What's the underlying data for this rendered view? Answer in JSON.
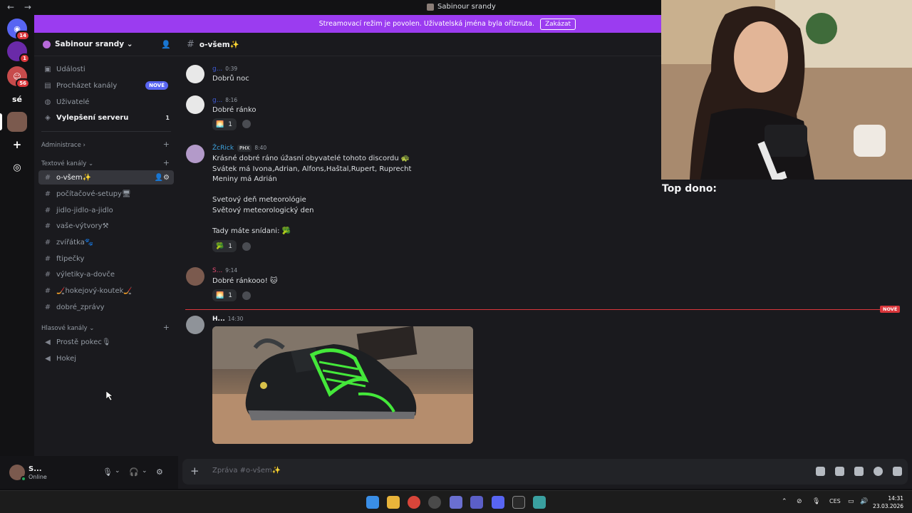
{
  "titlebar": {
    "back": "←",
    "forward": "→",
    "title": "Sabinour srandy"
  },
  "rail": {
    "servers": [
      {
        "name": "discord-home",
        "badge": "14",
        "color": "#5865f2",
        "glyph": "◉"
      },
      {
        "name": "purple-server",
        "badge": "1",
        "color": "#6a2aa8",
        "glyph": ""
      },
      {
        "name": "emoji-server",
        "badge": "56",
        "color": "#c74b4b",
        "glyph": "☺"
      },
      {
        "name": "se-server",
        "badge": "",
        "color": "#121214",
        "glyph": "sé"
      },
      {
        "name": "sabinour-server",
        "badge": "",
        "color": "#7b5a4e",
        "glyph": ""
      },
      {
        "name": "add-server",
        "badge": "",
        "color": "#121214",
        "glyph": "+"
      },
      {
        "name": "discover",
        "badge": "",
        "color": "#121214",
        "glyph": "◎"
      }
    ]
  },
  "banner": {
    "text": "Streamovací režim je povolen. Uživatelská jména byla oříznuta.",
    "button": "Zakázat"
  },
  "sidebar": {
    "server_name": "Sabinour srandy ⌄",
    "top_items": [
      {
        "label": "Události",
        "icon": "▣"
      },
      {
        "label": "Procházet kanály",
        "icon": "▤",
        "pill": "NOVÉ"
      },
      {
        "label": "Uživatelé",
        "icon": "👥"
      },
      {
        "label": "Vylepšení serveru",
        "icon": "◈",
        "count": "1"
      }
    ],
    "categories": {
      "admin": "Administrace ›",
      "text": "Textové kanály ⌄",
      "voice": "Hlasové kanály ⌄"
    },
    "text_channels": [
      "o-všem✨",
      "počítačové-setupy🖥",
      "jidlo-jidlo-a-jidlo",
      "vaše-výtvory⚒",
      "zvířátka🐾",
      "ftipečky",
      "výletiky-a-dovče",
      "🏒hokejový-koutek🏒",
      "dobré_zprávy"
    ],
    "voice_channels": [
      "Prostě pokec🎙",
      "Hokej"
    ]
  },
  "user": {
    "name": "S...",
    "status": "Online"
  },
  "chat": {
    "channel": "o-všem✨",
    "composer_placeholder": "Zpráva #o-všem✨",
    "new_tag": "NOVÉ",
    "messages": [
      {
        "author": "g...",
        "time": "0:39",
        "text": "Dobrů noc"
      },
      {
        "author": "g...",
        "time": "8:16",
        "text": "Dobré ránko",
        "reaction_count": "1"
      },
      {
        "author": "ŽcRick",
        "tag": "PHX",
        "time": "8:40",
        "text": "Krásné dobré ráno úžasní obyvatelé tohoto discordu 🐢\nSvátek má Ivona,Adrian, Alfons,Haštal,Rupert, Ruprecht\nMeniny má Adrián\n\nSvetový deň meteorológie\nSvětový meteorologický den\n\nTady máte snídani: 🥦",
        "reaction_count": "1"
      },
      {
        "author": "S...",
        "time": "9:14",
        "text": "Dobré ránkooo! 🐱",
        "reaction_count": "1"
      },
      {
        "author": "H...",
        "time": "14:30",
        "text": ""
      }
    ]
  },
  "cam": {
    "caption": "Top dono:"
  },
  "taskbar": {
    "lang": "CES",
    "time": "14:31",
    "date": "23.03.2026",
    "apps": [
      {
        "name": "windows-start",
        "color": "#3a8ee6"
      },
      {
        "name": "file-explorer",
        "color": "#e8b43a"
      },
      {
        "name": "chrome",
        "color": "#d8453a"
      },
      {
        "name": "obs",
        "color": "#4a4a4a"
      },
      {
        "name": "app-5",
        "color": "#6a6fd0"
      },
      {
        "name": "app-6",
        "color": "#5b5fc7"
      },
      {
        "name": "discord",
        "color": "#5865f2"
      },
      {
        "name": "epic-games",
        "color": "#2a2a2a"
      },
      {
        "name": "app-9",
        "color": "#3aa0a0"
      }
    ]
  }
}
